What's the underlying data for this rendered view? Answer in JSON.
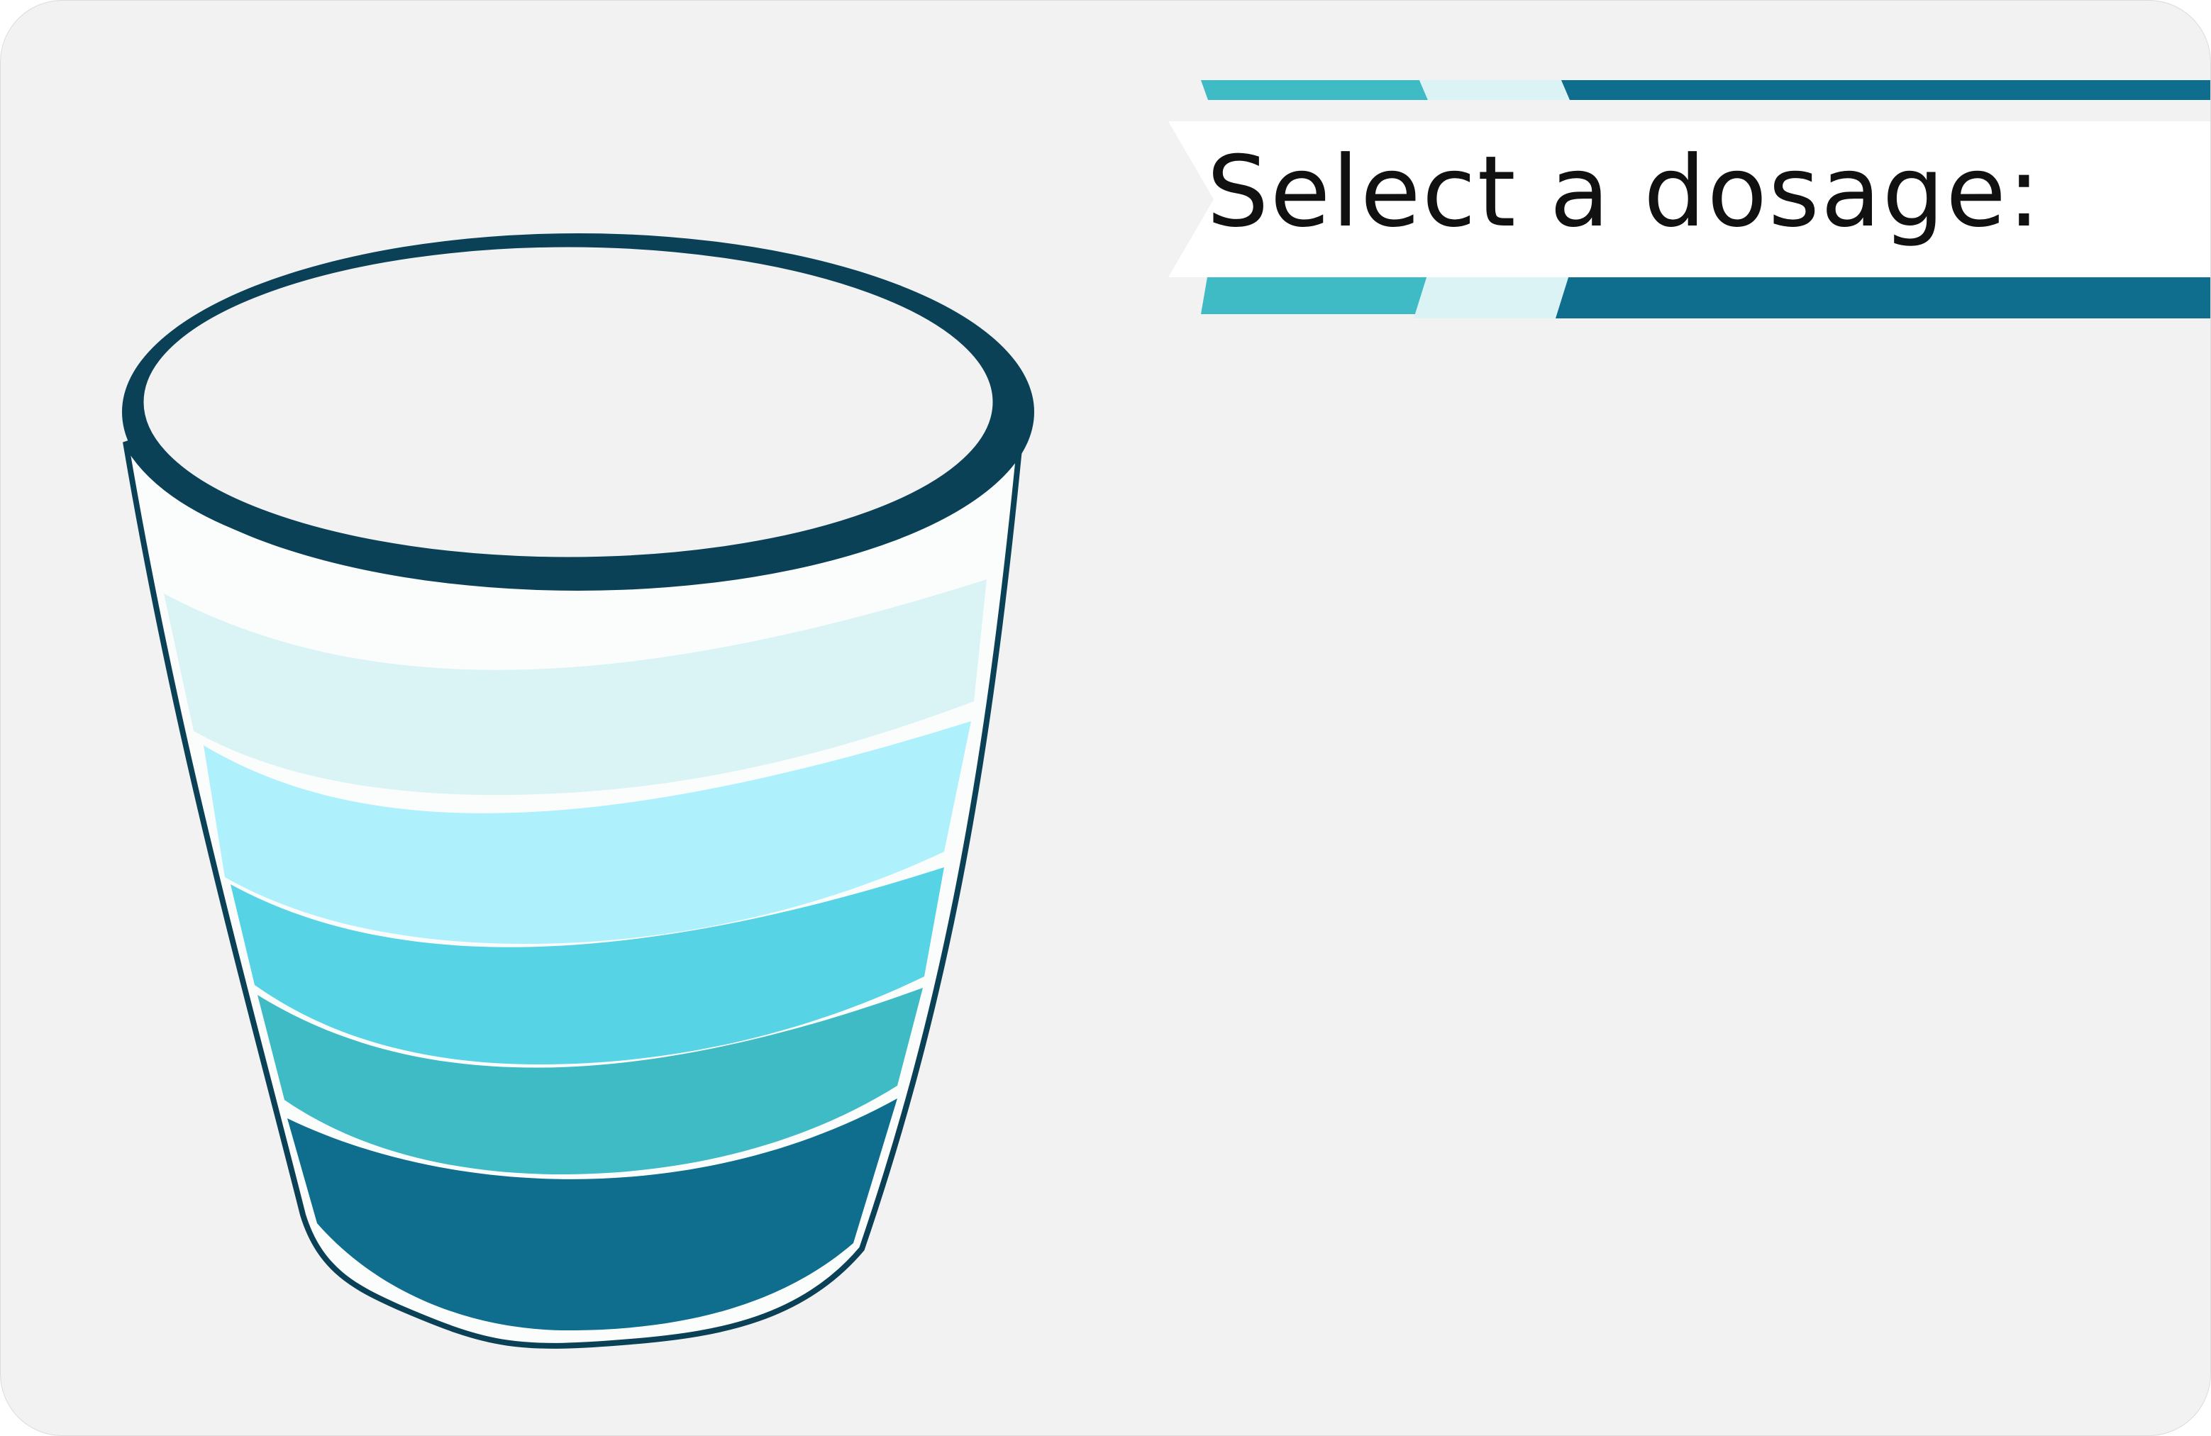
{
  "prompt": {
    "text": "Select a dosage:"
  },
  "colors": {
    "background": "#f2f2f2",
    "outline": "#0b4157",
    "banner_dark": "#0f6d8d",
    "banner_teal": "#3fbbc6",
    "banner_pale": "#dbf3f5",
    "banner_white": "#ffffff"
  },
  "cup": {
    "layers": [
      {
        "name": "dosage-level-1",
        "color": "#0f6d8d"
      },
      {
        "name": "dosage-level-2",
        "color": "#3fbbc6"
      },
      {
        "name": "dosage-level-3",
        "color": "#57d3e6"
      },
      {
        "name": "dosage-level-4",
        "color": "#aef0fb"
      },
      {
        "name": "dosage-level-5",
        "color": "#daf3f5"
      }
    ]
  }
}
